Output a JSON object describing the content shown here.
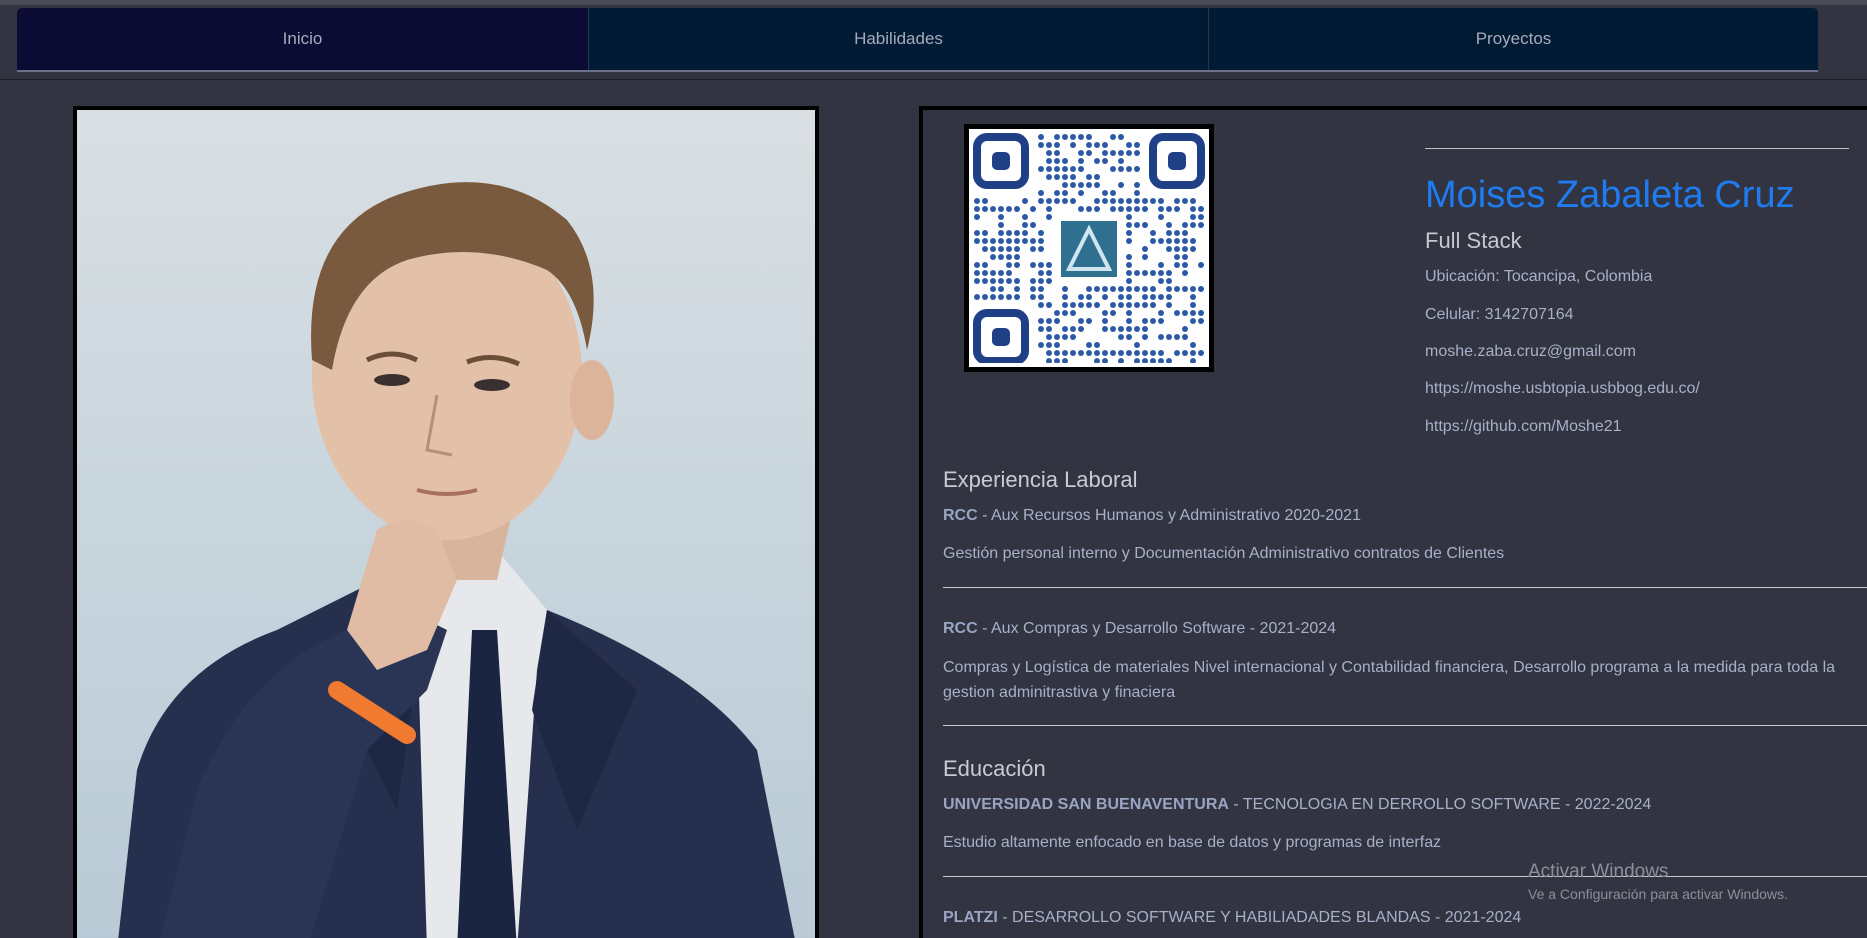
{
  "nav": {
    "tabs": [
      {
        "label": "Inicio"
      },
      {
        "label": "Habilidades"
      },
      {
        "label": "Proyectos"
      }
    ]
  },
  "profile": {
    "name": "Moises Zabaleta Cruz",
    "role": "Full Stack",
    "location": "Ubicación: Tocancipa, Colombia",
    "phone": "Celular: 3142707164",
    "email": "moshe.zaba.cruz@gmail.com",
    "website": "https://moshe.usbtopia.usbbog.edu.co/",
    "github": "https://github.com/Moshe21"
  },
  "experience": {
    "title": "Experiencia Laboral",
    "items": [
      {
        "company": "RCC",
        "detail": " - Aux Recursos Humanos y Administrativo 2020-2021",
        "description": "Gestión personal interno y Documentación Administrativo contratos de Clientes"
      },
      {
        "company": "RCC",
        "detail": " - Aux Compras y Desarrollo Software - 2021-2024",
        "description": "Compras y Logística de materiales Nivel internacional y Contabilidad financiera, Desarrollo programa a la medida para toda la gestion adminitrastiva y finaciera"
      }
    ]
  },
  "education": {
    "title": "Educación",
    "items": [
      {
        "school": "UNIVERSIDAD SAN BUENAVENTURA",
        "detail": " - TECNOLOGIA EN DERROLLO SOFTWARE - 2022-2024",
        "description": "Estudio altamente enfocado en base de datos y programas de interfaz"
      },
      {
        "school": "PLATZI",
        "detail": " - DESARROLLO SOFTWARE Y HABILIADADES BLANDAS - 2021-2024"
      }
    ]
  },
  "watermark": {
    "title": "Activar Windows",
    "subtitle": "Ve a Configuración para activar Windows."
  },
  "colors": {
    "background": "#323442",
    "accent_name": "#1e7cf0",
    "nav_active": "#0c0b33",
    "nav_inactive": "#011b34",
    "qr_dots": "#2d5aa8"
  }
}
